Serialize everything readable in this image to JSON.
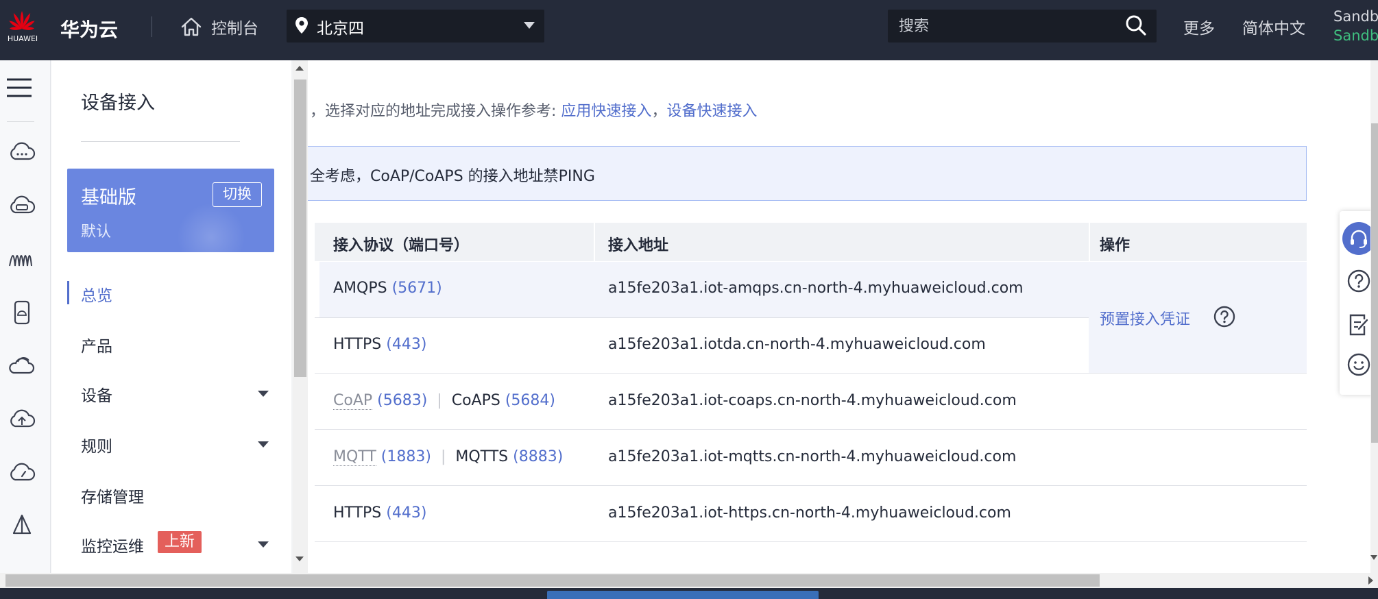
{
  "topbar": {
    "logo_text": "HUAWEI",
    "brand": "华为云",
    "console_label": "控制台",
    "region": "北京四",
    "search_placeholder": "搜索",
    "more": "更多",
    "language": "简体中文",
    "user_line1": "Sandbox",
    "user_line2": "Sandbox"
  },
  "sidemenu": {
    "title": "设备接入",
    "edition_name": "基础版",
    "edition_sub": "默认",
    "switch_label": "切换",
    "items": [
      {
        "label": "总览"
      },
      {
        "label": "产品"
      },
      {
        "label": "设备"
      },
      {
        "label": "规则"
      },
      {
        "label": "存储管理"
      },
      {
        "label": "监控运维"
      }
    ],
    "new_badge": "上新"
  },
  "main": {
    "intro_prefix": "，选择对应的地址完成接入操作参考: ",
    "intro_link1": "应用快速接入",
    "intro_sep": "，",
    "intro_link2": "设备快速接入",
    "notice": "全考虑，CoAP/CoAPS 的接入地址禁PING",
    "table": {
      "headers": [
        "接入协议（端口号）",
        "接入地址",
        "操作"
      ],
      "rows": [
        {
          "p1": "AMQPS",
          "port1": "(5671)",
          "address": "a15fe203a1.iot-amqps.cn-north-4.myhuaweicloud.com"
        },
        {
          "p1": "HTTPS",
          "port1": "(443)",
          "address": "a15fe203a1.iotda.cn-north-4.myhuaweicloud.com"
        },
        {
          "p1": "CoAP",
          "port1": "(5683)",
          "sep": "|",
          "p2": "CoAPS",
          "port2": "(5684)",
          "address": "a15fe203a1.iot-coaps.cn-north-4.myhuaweicloud.com"
        },
        {
          "p1": "MQTT",
          "port1": "(1883)",
          "sep": "|",
          "p2": "MQTTS",
          "port2": "(8883)",
          "address": "a15fe203a1.iot-mqtts.cn-north-4.myhuaweicloud.com"
        },
        {
          "p1": "HTTPS",
          "port1": "(443)",
          "address": "a15fe203a1.iot-https.cn-north-4.myhuaweicloud.com"
        }
      ],
      "action_link": "预置接入凭证"
    }
  },
  "colors": {
    "topbar": "#252b3a",
    "accent": "#526ecc",
    "edition_card": "#6a86e0",
    "badge": "#e45f5b",
    "user_green": "#3fbf7f"
  }
}
